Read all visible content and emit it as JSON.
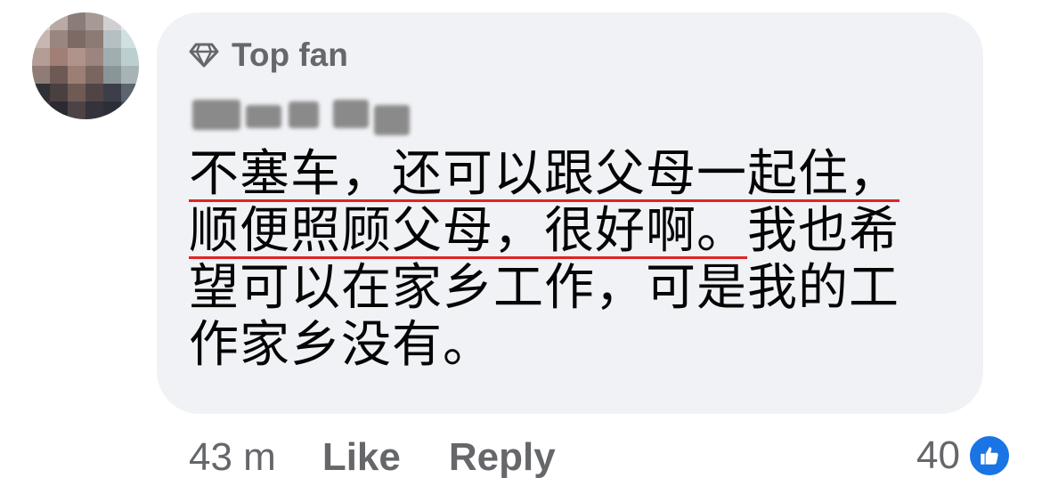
{
  "comment": {
    "badge": "Top fan",
    "badge_icon": "diamond-icon",
    "lines": [
      "不塞车，还可以跟父母一起住，",
      "顺便照顾父母，很好啊。",
      "我也希",
      "望可以在家乡工作，可是我的工",
      "作家乡没有。"
    ]
  },
  "footer": {
    "time": "43 m",
    "like_label": "Like",
    "reply_label": "Reply",
    "reaction_count": "40",
    "reaction_icon": "thumbs-up-icon"
  },
  "colors": {
    "bubble_bg": "#f0f2f5",
    "secondary_text": "#65676b",
    "underline": "#e02424",
    "like_blue": "#1b74e4"
  }
}
